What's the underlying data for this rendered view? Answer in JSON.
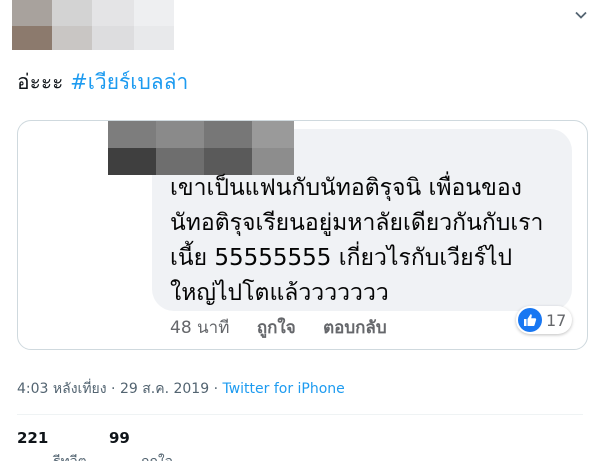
{
  "tweet": {
    "text_prefix": "อ่ะะะ",
    "hashtag": "#เวียร์เบลล่า"
  },
  "quoted_comment": {
    "lines": [
      "เขาเป็นแฟนกับนัทอติรุจนิ เพื่อนของ",
      "นัทอติรุจเรียนอยู่มหาลัยเดียวกันกับเรา",
      "เนี้ย 55555555 เกี่ยวไรกับเวียร์ไป",
      "ใหญ่ไปโตแล้ววววววว"
    ],
    "time_ago": "48 นาที",
    "like_action": "ถูกใจ",
    "reply_action": "ตอบกลับ",
    "reaction_count": "17",
    "reaction_icon": "thumbs-up-icon",
    "reaction_color": "#1877f2"
  },
  "meta": {
    "time": "4:03 หลังเที่ยง",
    "separator": "·",
    "date": "29 ส.ค. 2019",
    "source": "Twitter for iPhone"
  },
  "stats": {
    "retweets": "221",
    "retweets_label": "รีทวีต",
    "likes": "99",
    "likes_label": "ถูกใจ"
  },
  "colors": {
    "link": "#1d9bf0",
    "bubble": "#f0f2f5",
    "secondary_text": "#536471"
  }
}
